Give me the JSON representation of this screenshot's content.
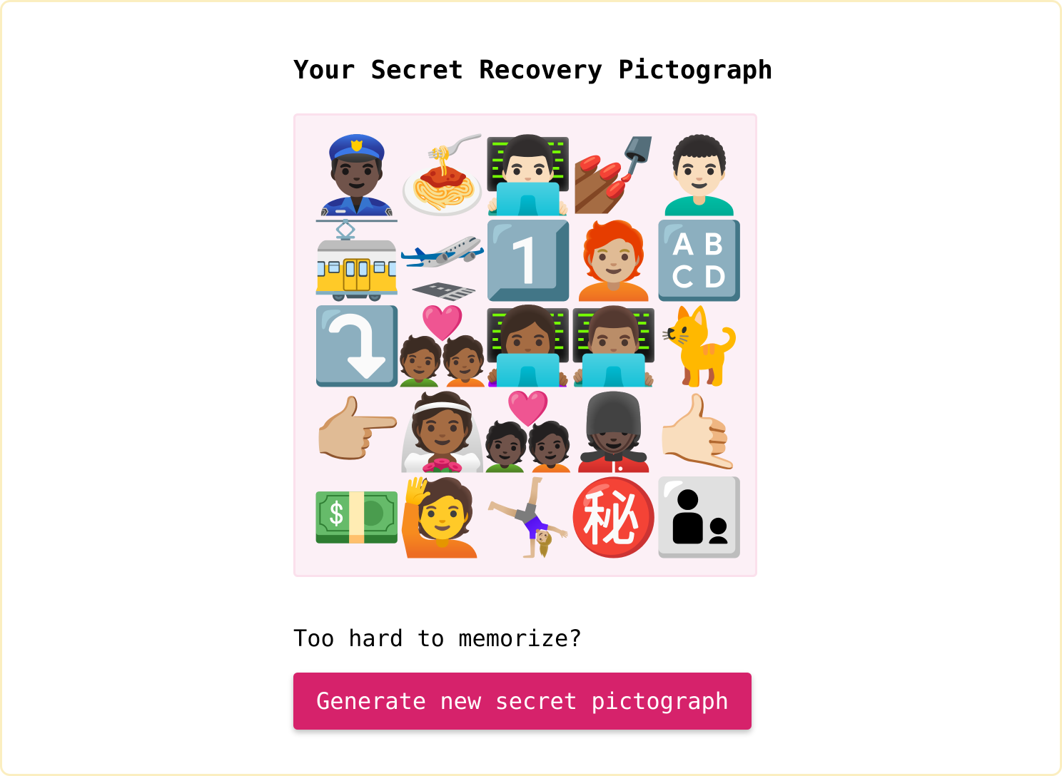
{
  "page": {
    "title": "Your Secret Recovery Pictograph",
    "prompt": "Too hard to memorize?",
    "generate_button": "Generate new secret pictograph"
  },
  "pictograph": {
    "rows": [
      [
        {
          "name": "police-officer-icon",
          "glyph": "👮🏿‍♂️"
        },
        {
          "name": "spaghetti-icon",
          "glyph": "🍝"
        },
        {
          "name": "technologist-icon",
          "glyph": "👨🏻‍💻"
        },
        {
          "name": "nail-polish-icon",
          "glyph": "💅🏾"
        },
        {
          "name": "man-with-mustache-icon",
          "glyph": "👨🏻‍🦱"
        }
      ],
      [
        {
          "name": "tram-car-icon",
          "glyph": "🚋"
        },
        {
          "name": "airplane-departure-icon",
          "glyph": "🛫"
        },
        {
          "name": "keycap-one-icon",
          "glyph": "1️⃣"
        },
        {
          "name": "person-red-hair-icon",
          "glyph": "🧑🏼‍🦰"
        },
        {
          "name": "abcd-input-icon",
          "glyph": "🔠"
        }
      ],
      [
        {
          "name": "arrow-curving-down-icon",
          "glyph": "⤵️"
        },
        {
          "name": "couple-with-heart-icon",
          "glyph": "💑🏾"
        },
        {
          "name": "woman-technologist-icon",
          "glyph": "👩🏾‍💻"
        },
        {
          "name": "man-technologist-icon",
          "glyph": "👨🏽‍💻"
        },
        {
          "name": "cat-icon",
          "glyph": "🐈"
        }
      ],
      [
        {
          "name": "pointing-right-icon",
          "glyph": "👉🏼"
        },
        {
          "name": "bride-with-veil-icon",
          "glyph": "👰🏾"
        },
        {
          "name": "couple-with-heart-mixed-icon",
          "glyph": "💑🏿"
        },
        {
          "name": "guard-icon",
          "glyph": "💂🏿"
        },
        {
          "name": "call-me-hand-icon",
          "glyph": "🤙🏻"
        }
      ],
      [
        {
          "name": "dollar-banknote-icon",
          "glyph": "💵"
        },
        {
          "name": "person-raising-hand-icon",
          "glyph": "🙋"
        },
        {
          "name": "cartwheel-icon",
          "glyph": "🤸🏼‍♀️"
        },
        {
          "name": "secret-ideograph-icon",
          "glyph": "㊙️"
        },
        {
          "name": "man-and-boy-icon",
          "glyph": "👨‍👦"
        }
      ]
    ]
  },
  "colors": {
    "accent": "#d6226b",
    "pictograph_background": "#fcf0f6",
    "pictograph_border": "#fbe0ec",
    "frame_border": "#fbeec0"
  }
}
